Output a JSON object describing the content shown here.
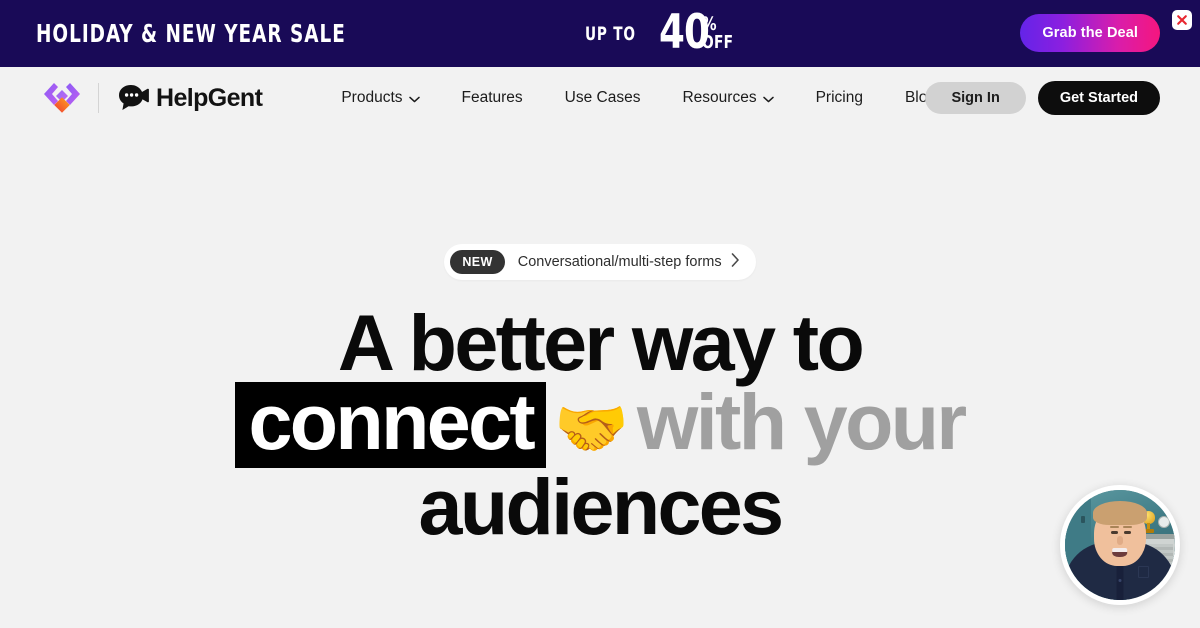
{
  "promo": {
    "title": "HOLIDAY & NEW YEAR SALE",
    "up_to_label": "UP TO",
    "discount_number": "40",
    "percent_symbol": "%",
    "off_label": "OFF",
    "cta_label": "Grab the Deal",
    "close_icon": "close-x-icon",
    "bg_color": "#190a57",
    "cta_gradient_from": "#6424e8",
    "cta_gradient_to": "#f5167e",
    "close_icon_color": "#e8262f"
  },
  "header": {
    "brand_mark_icon": "helpgent-diamond-mark-icon",
    "brand_icon": "video-chat-bubble-icon",
    "brand_name": "HelpGent",
    "nav": [
      {
        "label": "Products",
        "has_dropdown": true
      },
      {
        "label": "Features",
        "has_dropdown": false
      },
      {
        "label": "Use Cases",
        "has_dropdown": false
      },
      {
        "label": "Resources",
        "has_dropdown": true
      },
      {
        "label": "Pricing",
        "has_dropdown": false
      },
      {
        "label": "Blog",
        "has_dropdown": false
      }
    ],
    "sign_in_label": "Sign In",
    "get_started_label": "Get Started",
    "bg_color": "#f2f2f2"
  },
  "hero": {
    "badge_label": "NEW",
    "badge_text": "Conversational/multi-step forms",
    "badge_chevron_icon": "chevron-right-icon",
    "headline_line1": "A better way to",
    "headline_highlight": "connect",
    "headline_emoji": "🤝",
    "headline_muted": "with your",
    "headline_line3": "audiences",
    "highlight_bg": "#000000",
    "muted_color": "#a0a0a0",
    "bg_color": "#f2f2f2"
  },
  "video_widget": {
    "name": "floating-video-avatar",
    "alt": "presenter speaking to camera"
  }
}
